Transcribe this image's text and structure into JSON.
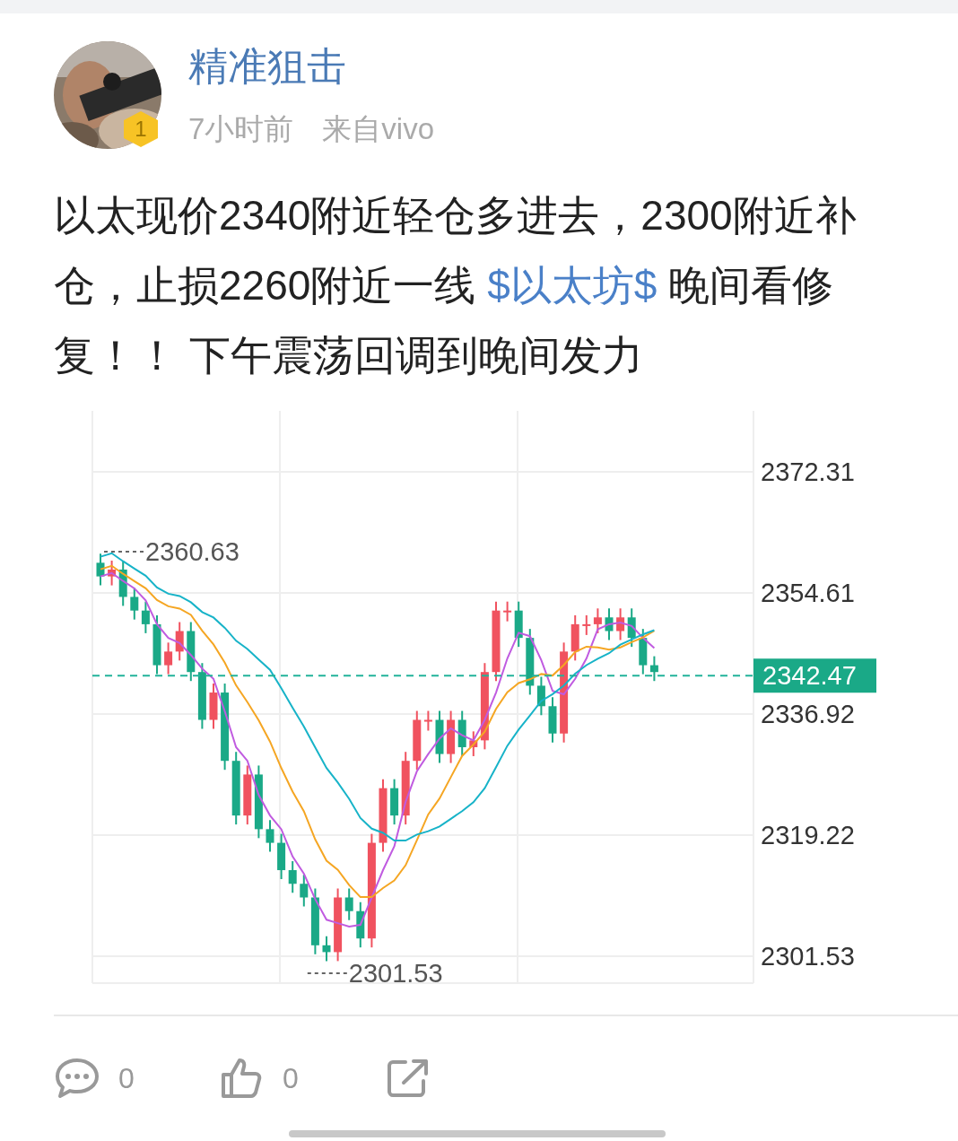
{
  "post": {
    "author": {
      "name": "精准狙击",
      "badge": "1"
    },
    "time": "7小时前",
    "source": "来自vivo",
    "text": [
      {
        "kind": "plain",
        "text": "以太现价2340附近轻仓多进去，2300附近补仓，止损2260附近一线 "
      },
      {
        "kind": "topic",
        "text": "$以太坊$"
      },
      {
        "kind": "plain",
        "text": " 晚间看修复！！ 下午震荡回调到晚间发力"
      }
    ],
    "kline": {
      "price_labels": [
        "2372.31",
        "2354.61",
        "2336.92",
        "2319.22",
        "2301.53"
      ],
      "high_label": "2360.63",
      "low_label": "2301.53",
      "last_price": "2342.47"
    },
    "actions": [
      {
        "kind": "comment",
        "count": "0"
      },
      {
        "kind": "like",
        "count": "0"
      },
      {
        "kind": "share"
      }
    ]
  }
}
